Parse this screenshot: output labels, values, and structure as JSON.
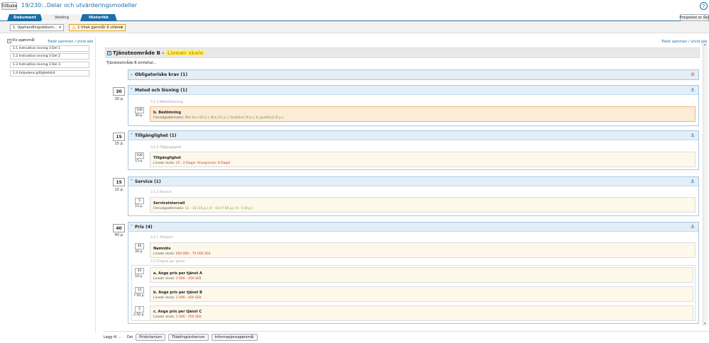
{
  "header": {
    "back_label": "Tillbake",
    "title": "19/230:..Delar och utvärderingsmodeller",
    "help_icon": "question-circle-icon",
    "project_button": "Prosjektet er låst"
  },
  "tabs": [
    {
      "label": "Dokument"
    },
    {
      "label": "Veiding"
    },
    {
      "label": "Historikk"
    }
  ],
  "toolbar": {
    "doc_select": "1. Upphandlingsdokum...",
    "warning_label": "1 tiltak gjenstår å utføres",
    "warning_icon": "warning-triangle-icon"
  },
  "left_panel": {
    "checkbox_label": "Vis spørsmål",
    "toggle_link": "Trekk sammen / utvid alle",
    "items": [
      "1.1 Instruktion övning 3 Del 1",
      "1.2 Instruktion övning 3 Del 2",
      "1.3 Instruktion övning 3 Del 3",
      "1.4 Anbudens giltighetstid"
    ]
  },
  "main": {
    "toggle_link": "Trekk sammen / utvid alle",
    "area_title": "Tjänsteområde B - ",
    "area_highlight": "Lineær skala",
    "area_desc": "Tjänsteområde B omfattar...",
    "obligatory": "Obligatoriske krav (1)",
    "sections": [
      {
        "weight": "30",
        "points": "30 p.",
        "title": "Metod och lösning (1)",
        "subheading": "3.1.1 Metod/Lösning",
        "cards": [
          {
            "num": "100",
            "pts": "30 p.",
            "title": "b. Bedömning",
            "prefix": "Flervalgsalternativ: ",
            "detail": "Mkt bra (30 p.); Bra (21 p.); Godkänd (9 p.); Ej godkänd (0 p.)"
          }
        ]
      },
      {
        "weight": "15",
        "points": "15 p.",
        "title": "Tillgänglighet (1)",
        "subheading": "3.1.3 Tillgänglighet",
        "cards": [
          {
            "num": "100",
            "pts": "15 p.",
            "title": "Tillgänglighet",
            "prefix": "Lineær skala: ",
            "detail": "15 - 2 Dagar. Kravgrense: 8 Dagar"
          }
        ]
      },
      {
        "weight": "15",
        "points": "15 p.",
        "title": "Service (1)",
        "subheading": "3.1.2 Service",
        "cards": [
          {
            "num": "5",
            "pts": "15 p.",
            "title": "Serviceintervall",
            "prefix": "Flervalgsalternativ: ",
            "detail": "11 - 15 (15 p.); 6 - 10 (7.50 p.); 0 - 5 (0 p.)"
          }
        ]
      },
      {
        "weight": "40",
        "points": "40 p.",
        "title": "Pris (4)",
        "subheading": "3.2.1 Totalpris",
        "subheading2": "3.3 Timpris per tjänst",
        "cards": [
          {
            "num": "40",
            "pts": "20 p.",
            "title": "Namnlös",
            "prefix": "Lineær skala: ",
            "detail": "200 000 - 75 000 SEK"
          },
          {
            "num": "20",
            "pts": "10 p.",
            "title": "a. Ange pris per tjänst A",
            "prefix": "Lineær skala: ",
            "detail": "1 000 - 450 SEK"
          },
          {
            "num": "15",
            "pts": "7.50 p.",
            "title": "b. Ange pris per tjänst B",
            "prefix": "Lineær skala: ",
            "detail": "1 000 - 450 SEK"
          },
          {
            "num": "5",
            "pts": "2.50 p.",
            "title": "c. Ange pris per tjänst C",
            "prefix": "Lineær skala: ",
            "detail": "1 000 - 450 SEK"
          }
        ]
      }
    ]
  },
  "bottom": {
    "add_label": "Legg til ...",
    "part_label": "Del",
    "buttons": [
      "Priskriterium",
      "Tildelingskriterium",
      "Informasjonsspørsmål"
    ]
  },
  "colors": {
    "accent": "#1b6ea8",
    "highlight": "#fff36b",
    "card": "#fdf8ea",
    "card_selected": "#fcebd6"
  }
}
